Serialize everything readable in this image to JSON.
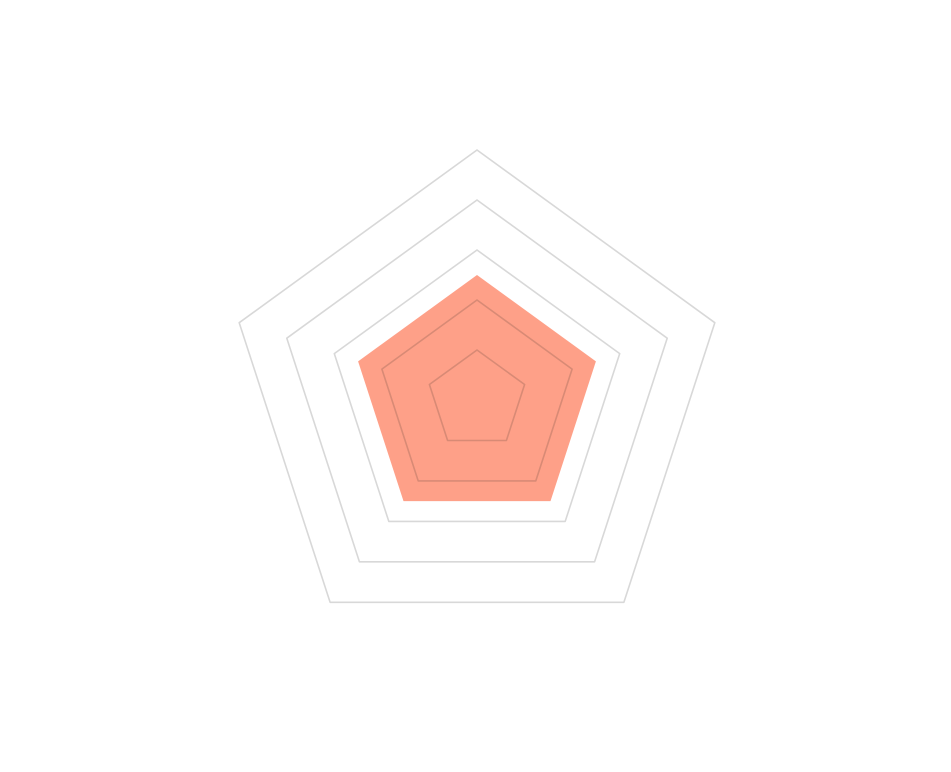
{
  "chart_data": {
    "type": "radar",
    "title": "",
    "axes": [
      "",
      "",
      "",
      "",
      ""
    ],
    "rmax": 5,
    "grid_levels": [
      1,
      2,
      3,
      4,
      5
    ],
    "series": [
      {
        "name": "",
        "values": [
          2.5,
          2.5,
          2.5,
          2.5,
          2.5
        ]
      }
    ],
    "grid": true,
    "legend": "none"
  },
  "colors": {
    "series_fill": "#fe8f73",
    "series_opacity": "0.85",
    "grid_line": "#d8d8d8",
    "background": "#ffffff"
  }
}
